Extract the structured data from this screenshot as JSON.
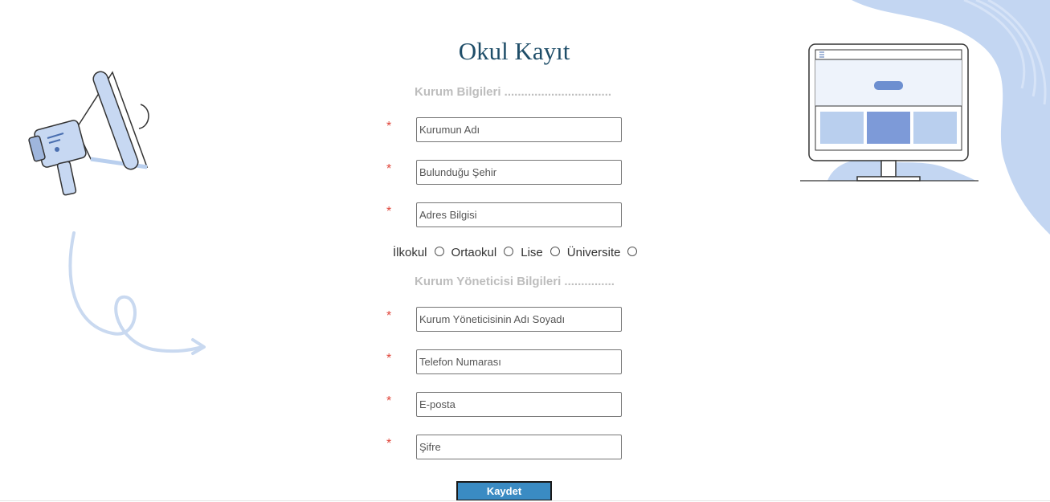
{
  "page": {
    "title": "Okul Kayıt"
  },
  "sections": {
    "institution_heading": "Kurum Bilgileri ................................",
    "manager_heading": "Kurum Yöneticisi Bilgileri ..............."
  },
  "required_marker": "*",
  "institution_fields": [
    {
      "placeholder": "Kurumun Adı",
      "value": ""
    },
    {
      "placeholder": "Bulunduğu Şehir",
      "value": ""
    },
    {
      "placeholder": "Adres Bilgisi",
      "value": ""
    }
  ],
  "school_types": [
    {
      "label": "İlkokul",
      "checked": false
    },
    {
      "label": "Ortaokul",
      "checked": false
    },
    {
      "label": "Lise",
      "checked": false
    },
    {
      "label": "Üniversite",
      "checked": false
    }
  ],
  "manager_fields": [
    {
      "placeholder": "Kurum Yöneticisinin Adı Soyadı",
      "value": ""
    },
    {
      "placeholder": "Telefon Numarası",
      "value": ""
    },
    {
      "placeholder": "E-posta",
      "value": ""
    },
    {
      "placeholder": "Şifre",
      "value": ""
    }
  ],
  "submit": {
    "label": "Kaydet"
  },
  "colors": {
    "title": "#1f4e69",
    "heading": "#bdbdbd",
    "required": "#e0453a",
    "accent_button": "#3a8bc3",
    "decor_blue": "#b9cfee"
  },
  "decorations": {
    "left_illustration": "megaphone-icon",
    "left_arrow": "curly-arrow-icon",
    "right_illustration": "desktop-monitor-icon",
    "corner_shape": "wave-blob"
  }
}
